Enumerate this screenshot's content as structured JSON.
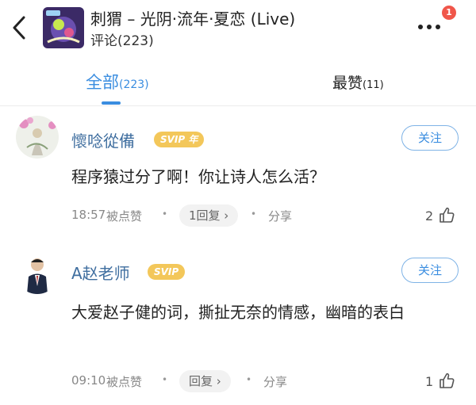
{
  "header": {
    "title": "刺猬 – 光阴·流年·夏恋 (Live)",
    "comment_count": "评论(223)",
    "notification_badge": "1",
    "back_icon": "chevron-left-icon",
    "more_icon": "more-dots-icon"
  },
  "tabs": {
    "all_label": "全部",
    "all_count": "(223)",
    "liked_label": "最赞",
    "liked_count": "(11)"
  },
  "comments": [
    {
      "username": "懷唸從備",
      "vip_badge": "SVIP 年",
      "follow_label": "关注",
      "text": "程序猿过分了啊！你让诗人怎么活？",
      "time": "18:57",
      "liked_by": "被点赞",
      "reply_label": "1回复 ›",
      "share_label": "分享",
      "likes": "2"
    },
    {
      "username": "A赵老师",
      "vip_badge": "SVIP",
      "follow_label": "关注",
      "text": "大爱赵子健的词，撕扯无奈的情感，幽暗的表白",
      "time": "09:10",
      "liked_by": "被点赞",
      "reply_label": "回复 ›",
      "share_label": "分享",
      "likes": "1"
    }
  ],
  "colors": {
    "accent": "#3a8de0",
    "username": "#3f6e9f",
    "vip": "#f3c75a",
    "badge": "#f0564a"
  }
}
